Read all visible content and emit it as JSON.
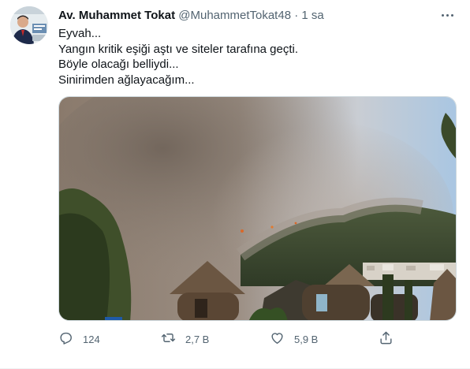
{
  "tweet": {
    "author_name": "Av. Muhammet Tokat",
    "handle": "@MuhammetTokat48",
    "separator": "·",
    "time": "1 sa",
    "lines": [
      "Eyvah...",
      "Yangın kritik eşiği aştı ve siteler tarafına geçti.",
      "Böyle olacağı belliydi...",
      "Sinirimden ağlayacağım..."
    ]
  },
  "actions": {
    "reply": {
      "icon": "reply-icon",
      "count": "124"
    },
    "retweet": {
      "icon": "retweet-icon",
      "count": "2,7 B"
    },
    "like": {
      "icon": "heart-icon",
      "count": "5,9 B"
    },
    "share": {
      "icon": "share-icon"
    }
  },
  "colors": {
    "text": "#0f1419",
    "secondary": "#536471",
    "border": "#cfd9de"
  }
}
